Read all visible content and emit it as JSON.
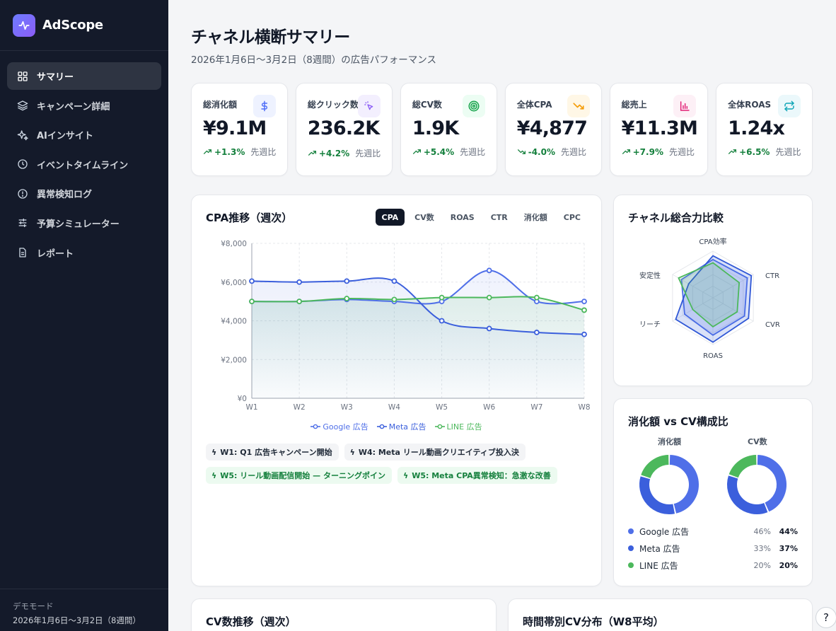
{
  "app": {
    "name": "AdScope"
  },
  "sidebar": {
    "items": [
      {
        "label": "サマリー",
        "icon": "grid-icon",
        "active": true
      },
      {
        "label": "キャンペーン詳細",
        "icon": "layers-icon"
      },
      {
        "label": "AIインサイト",
        "icon": "sparkle-icon"
      },
      {
        "label": "イベントタイムライン",
        "icon": "clock-icon"
      },
      {
        "label": "異常検知ログ",
        "icon": "alert-icon"
      },
      {
        "label": "予算シミュレーター",
        "icon": "sliders-icon"
      },
      {
        "label": "レポート",
        "icon": "document-icon"
      }
    ],
    "footer": {
      "mode": "デモモード",
      "period": "2026年1月6日〜3月2日（8週間）"
    }
  },
  "header": {
    "title": "チャネル横断サマリー",
    "subtitle": "2026年1月6日〜3月2日（8週間）の広告パフォーマンス"
  },
  "kpis": [
    {
      "label": "総消化額",
      "value": "¥9.1M",
      "delta": "+1.3%",
      "compare": "先週比",
      "trend": "up",
      "icon": "$",
      "icon_color": "#4f6ef7",
      "icon_bg": "#eef2ff"
    },
    {
      "label": "総クリック数",
      "value": "236.2K",
      "delta": "+4.2%",
      "compare": "先週比",
      "trend": "up",
      "icon": "cursor",
      "icon_color": "#8b5cf6",
      "icon_bg": "#f3effe"
    },
    {
      "label": "総CV数",
      "value": "1.9K",
      "delta": "+5.4%",
      "compare": "先週比",
      "trend": "up",
      "icon": "target",
      "icon_color": "#16a34a",
      "icon_bg": "#ecfdf3"
    },
    {
      "label": "全体CPA",
      "value": "¥4,877",
      "delta": "-4.0%",
      "compare": "先週比",
      "trend": "down",
      "icon": "trend-down",
      "icon_color": "#f59e0b",
      "icon_bg": "#fff7e6"
    },
    {
      "label": "総売上",
      "value": "¥11.3M",
      "delta": "+7.9%",
      "compare": "先週比",
      "trend": "up",
      "icon": "bar",
      "icon_color": "#e11d74",
      "icon_bg": "#fdf0f6"
    },
    {
      "label": "全体ROAS",
      "value": "1.24x",
      "delta": "+6.5%",
      "compare": "先週比",
      "trend": "up",
      "icon": "repeat",
      "icon_color": "#0ea5b7",
      "icon_bg": "#ebf8fb"
    }
  ],
  "cpa_card": {
    "title": "CPA推移（週次）",
    "tabs": [
      "CPA",
      "CV数",
      "ROAS",
      "CTR",
      "消化額",
      "CPC"
    ],
    "active_tab": "CPA",
    "events": [
      {
        "text": "W1: Q1 広告キャンペーン開始",
        "style": "gray"
      },
      {
        "text": "W4: Meta リール動画クリエイティブ投入決",
        "style": "gray"
      },
      {
        "text": "W5: リール動画配信開始 — ターニングポイン",
        "style": "green"
      },
      {
        "text": "W5: Meta CPA異常検知：急激な改善",
        "style": "green"
      }
    ]
  },
  "chart_data": [
    {
      "type": "line",
      "title": "CPA推移（週次）",
      "x": [
        "W1",
        "W2",
        "W3",
        "W4",
        "W5",
        "W6",
        "W7",
        "W8"
      ],
      "ylim": [
        0,
        8000
      ],
      "yticks": [
        "¥0",
        "¥2,000",
        "¥4,000",
        "¥6,000",
        "¥8,000"
      ],
      "grid": true,
      "legend": "bottom",
      "series": [
        {
          "name": "Google 広告",
          "color": "#4f6fe8",
          "values": [
            5000,
            5000,
            5100,
            5000,
            5000,
            6600,
            5000,
            5000
          ]
        },
        {
          "name": "Meta 広告",
          "color": "#3b5fdc",
          "values": [
            6050,
            6000,
            6050,
            6050,
            4000,
            3600,
            3400,
            3300
          ]
        },
        {
          "name": "LINE 広告",
          "color": "#4cb85c",
          "values": [
            5000,
            5000,
            5150,
            5100,
            5200,
            5200,
            5200,
            4550
          ]
        }
      ]
    },
    {
      "type": "radar",
      "title": "チャネル総合力比較",
      "axes": [
        "CPA効率",
        "CTR",
        "CVR",
        "ROAS",
        "リーチ",
        "安定性"
      ],
      "rmax": 100,
      "series": [
        {
          "name": "Google 広告",
          "color": "#4f6fe8",
          "values": [
            82,
            85,
            78,
            80,
            70,
            78
          ]
        },
        {
          "name": "Meta 広告",
          "color": "#2f57d6",
          "values": [
            90,
            95,
            88,
            95,
            92,
            60
          ]
        },
        {
          "name": "LINE 広告",
          "color": "#4cb85c",
          "values": [
            75,
            65,
            60,
            62,
            50,
            85
          ]
        }
      ]
    },
    {
      "type": "pie",
      "title": "消化額",
      "categories": [
        "Google 広告",
        "Meta 広告",
        "LINE 広告"
      ],
      "values": [
        46,
        33,
        20
      ]
    },
    {
      "type": "pie",
      "title": "CV数",
      "categories": [
        "Google 広告",
        "Meta 広告",
        "LINE 広告"
      ],
      "values": [
        44,
        37,
        20
      ]
    }
  ],
  "radar_card": {
    "title": "チャネル総合力比較"
  },
  "mix_card": {
    "title": "消化額 vs CV構成比",
    "spend_label": "消化額",
    "cv_label": "CV数",
    "rows": [
      {
        "name": "Google 広告",
        "spend": "46%",
        "cv": "44%",
        "color": "#4f6fe8"
      },
      {
        "name": "Meta 広告",
        "spend": "33%",
        "cv": "37%",
        "color": "#3b5fdc"
      },
      {
        "name": "LINE 広告",
        "spend": "20%",
        "cv": "20%",
        "color": "#4cb85c"
      }
    ]
  },
  "bottom": {
    "cv_title": "CV数推移（週次）",
    "hour_title": "時間帯別CV分布（W8平均）"
  },
  "help": {
    "label": "?"
  }
}
